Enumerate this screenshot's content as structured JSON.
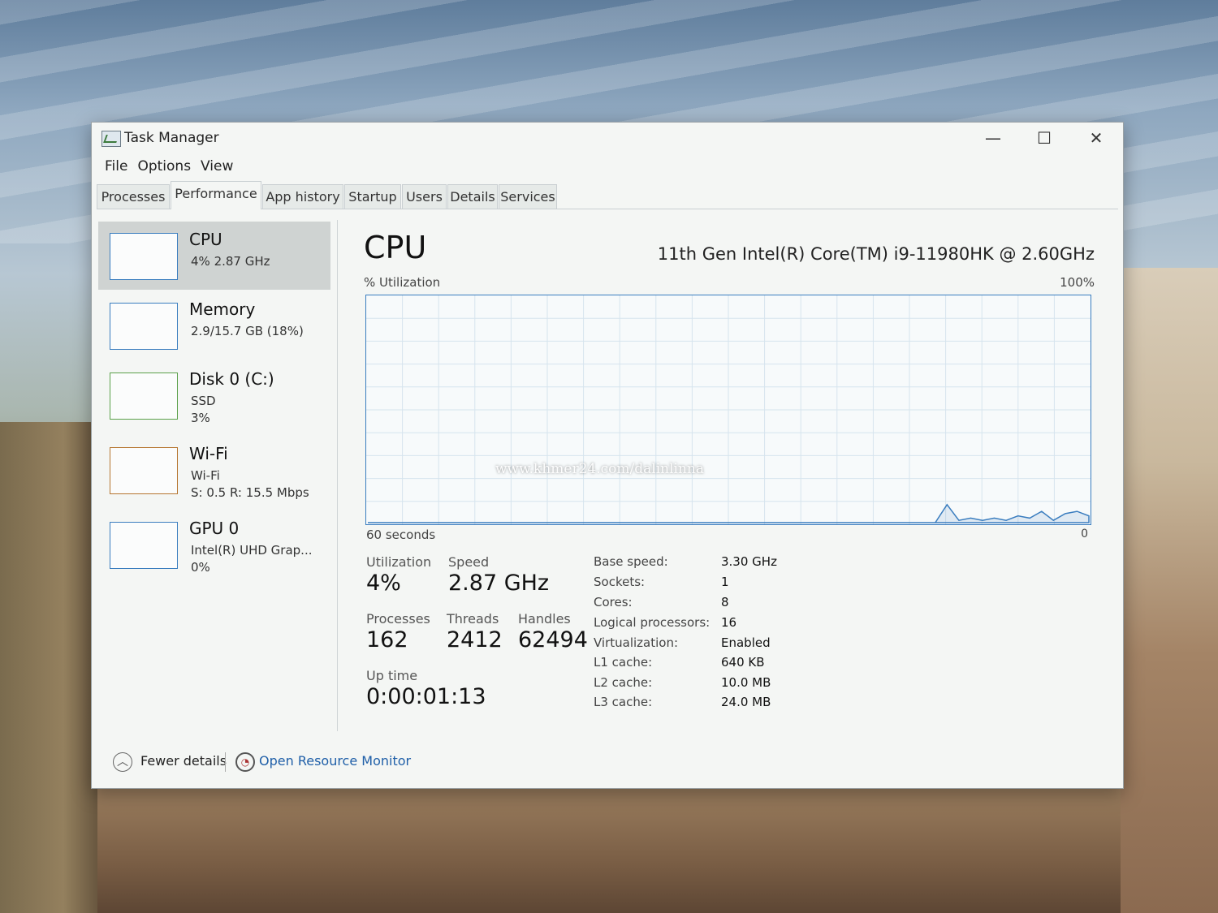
{
  "window": {
    "title": "Task Manager",
    "controls": {
      "minimize": "—",
      "maximize": "☐",
      "close": "✕"
    }
  },
  "menu": [
    "File",
    "Options",
    "View"
  ],
  "tabs": [
    {
      "label": "Processes",
      "active": false
    },
    {
      "label": "Performance",
      "active": true
    },
    {
      "label": "App history",
      "active": false
    },
    {
      "label": "Startup",
      "active": false
    },
    {
      "label": "Users",
      "active": false
    },
    {
      "label": "Details",
      "active": false
    },
    {
      "label": "Services",
      "active": false
    }
  ],
  "sidebar": [
    {
      "name": "CPU",
      "lines": [
        "4% 2.87 GHz"
      ],
      "selected": true
    },
    {
      "name": "Memory",
      "lines": [
        "2.9/15.7 GB (18%)"
      ],
      "selected": false
    },
    {
      "name": "Disk 0 (C:)",
      "lines": [
        "SSD",
        "3%"
      ],
      "selected": false
    },
    {
      "name": "Wi-Fi",
      "lines": [
        "Wi-Fi",
        "S: 0.5 R: 15.5 Mbps"
      ],
      "selected": false
    },
    {
      "name": "GPU 0",
      "lines": [
        "Intel(R) UHD Grap...",
        "0%"
      ],
      "selected": false
    }
  ],
  "main": {
    "title": "CPU",
    "model": "11th Gen Intel(R) Core(TM) i9-11980HK @ 2.60GHz",
    "graph_label": "% Utilization",
    "graph_max": "100%",
    "graph_window": "60 seconds",
    "graph_min": "0",
    "stats": {
      "utilization_label": "Utilization",
      "utilization": "4%",
      "speed_label": "Speed",
      "speed": "2.87 GHz",
      "processes_label": "Processes",
      "processes": "162",
      "threads_label": "Threads",
      "threads": "2412",
      "handles_label": "Handles",
      "handles": "62494",
      "uptime_label": "Up time",
      "uptime": "0:00:01:13"
    },
    "specs": [
      {
        "key": "Base speed:",
        "value": "3.30 GHz"
      },
      {
        "key": "Sockets:",
        "value": "1"
      },
      {
        "key": "Cores:",
        "value": "8"
      },
      {
        "key": "Logical processors:",
        "value": "16"
      },
      {
        "key": "Virtualization:",
        "value": "Enabled"
      },
      {
        "key": "L1 cache:",
        "value": "640 KB"
      },
      {
        "key": "L2 cache:",
        "value": "10.0 MB"
      },
      {
        "key": "L3 cache:",
        "value": "24.0 MB"
      }
    ],
    "cpu_history_percent": [
      0,
      0,
      0,
      0,
      0,
      0,
      0,
      0,
      0,
      0,
      0,
      0,
      0,
      0,
      0,
      0,
      0,
      0,
      0,
      0,
      0,
      0,
      0,
      0,
      0,
      0,
      0,
      0,
      0,
      0,
      0,
      0,
      0,
      0,
      0,
      0,
      0,
      0,
      0,
      0,
      0,
      0,
      0,
      0,
      0,
      0,
      0,
      0,
      0,
      8,
      1,
      2,
      1,
      2,
      1,
      3,
      2,
      5,
      1,
      4,
      5,
      3
    ]
  },
  "footer": {
    "fewer_details": "Fewer details",
    "open_resource_monitor": "Open Resource Monitor"
  },
  "watermark": "www.khmer24.com/dalinlinna",
  "colors": {
    "graph_line": "#3a7dbf",
    "link": "#1f5fa8",
    "selected_bg": "#cfd3d2"
  }
}
